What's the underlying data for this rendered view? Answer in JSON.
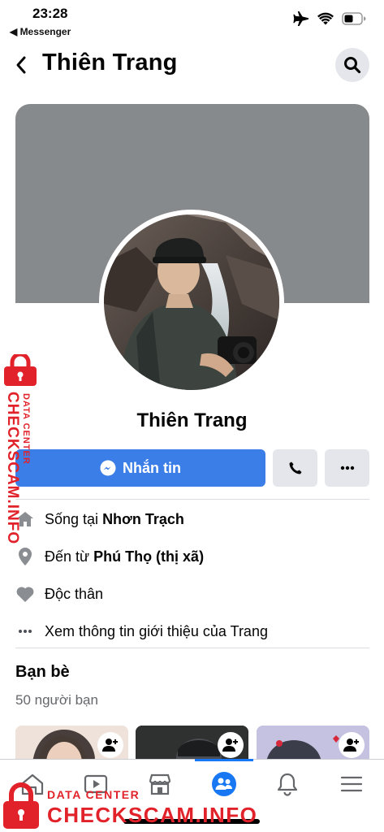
{
  "status_bar": {
    "time": "23:28",
    "back_app": "◀ Messenger"
  },
  "header": {
    "title": "Thiên Trang"
  },
  "profile": {
    "name": "Thiên Trang",
    "message_button": "Nhắn tin"
  },
  "info": [
    {
      "icon": "home-icon",
      "prefix": "Sống tại ",
      "value": "Nhơn Trạch"
    },
    {
      "icon": "location-pin-icon",
      "prefix": "Đến từ ",
      "value": "Phú Thọ (thị xã)"
    },
    {
      "icon": "heart-icon",
      "prefix": "",
      "value": "Độc thân"
    },
    {
      "icon": "more-dots-icon",
      "prefix": "",
      "value": "Xem thông tin giới thiệu của Trang"
    }
  ],
  "friends": {
    "title": "Bạn bè",
    "count": "50 người bạn"
  },
  "watermark": {
    "small_label": "DATA CENTER",
    "brand": "CHECKSCAM.INFO"
  },
  "colors": {
    "accent": "#1877f2",
    "message_button": "#3b7ee8",
    "cover": "#878a8c",
    "watermark": "#e1222a"
  }
}
